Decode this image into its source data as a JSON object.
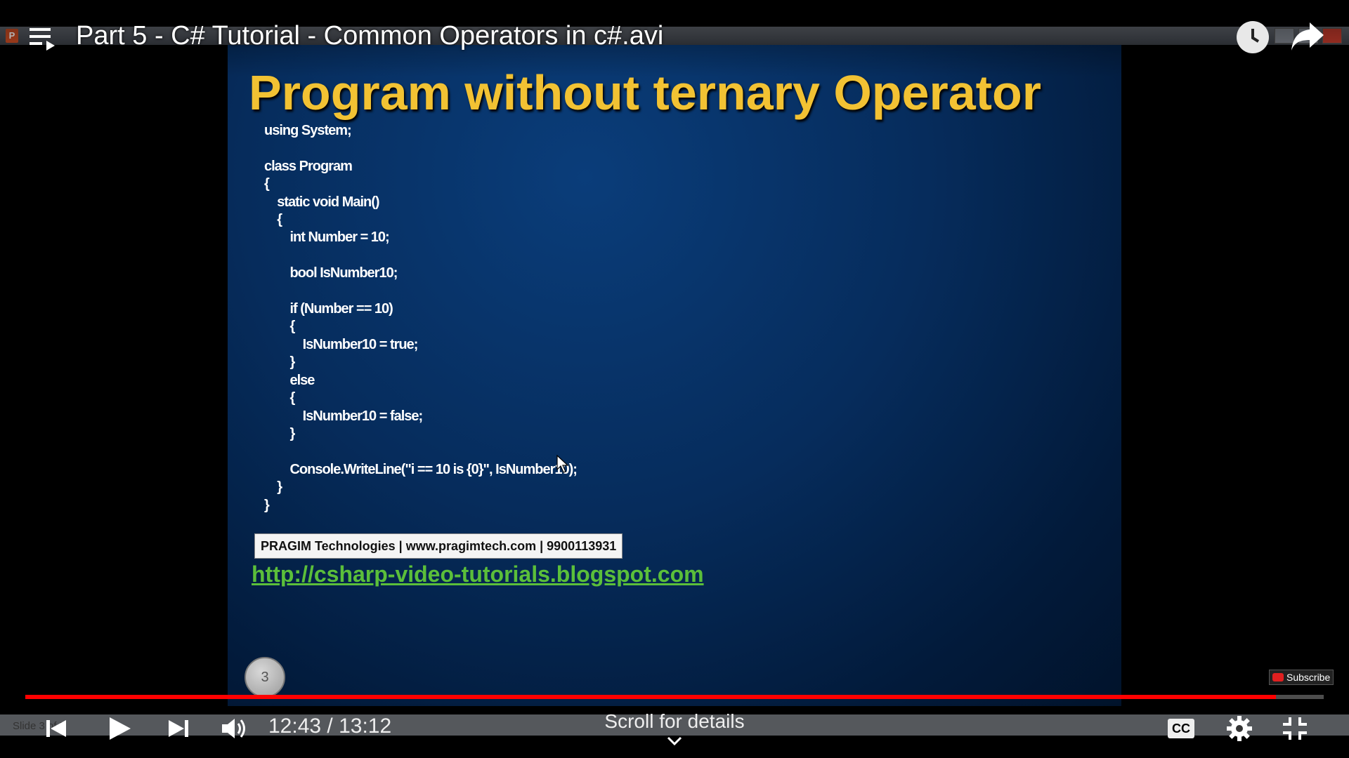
{
  "underlying_window": {
    "app_letter": "P",
    "status_text": "Slide 3 of 5"
  },
  "video": {
    "title": "Part 5 - C# Tutorial - Common Operators in c#.avi",
    "time": "12:43 / 13:12",
    "progress": 0.9634,
    "scroll_hint": "Scroll for details",
    "cc_label": "CC",
    "subscribe_label": "Subscribe"
  },
  "slide": {
    "title": "Program without ternary Operator",
    "code": "using System;\n\nclass Program\n{\n    static void Main()\n    {\n        int Number = 10;\n\n        bool IsNumber10;\n\n        if (Number == 10)\n        {\n            IsNumber10 = true;\n        }\n        else\n        {\n            IsNumber10 = false;\n        }\n\n        Console.WriteLine(\"i == 10 is {0}\", IsNumber10);\n    }\n}",
    "footer": "PRAGIM Technologies | www.pragimtech.com | 9900113931",
    "link": "http://csharp-video-tutorials.blogspot.com",
    "number": "3"
  },
  "icons": [
    "playlist-icon",
    "watch-later-icon",
    "share-icon",
    "previous-icon",
    "play-icon",
    "next-icon",
    "volume-icon",
    "chevron-down-icon",
    "settings-icon",
    "fullscreen-icon",
    "cursor-icon"
  ]
}
